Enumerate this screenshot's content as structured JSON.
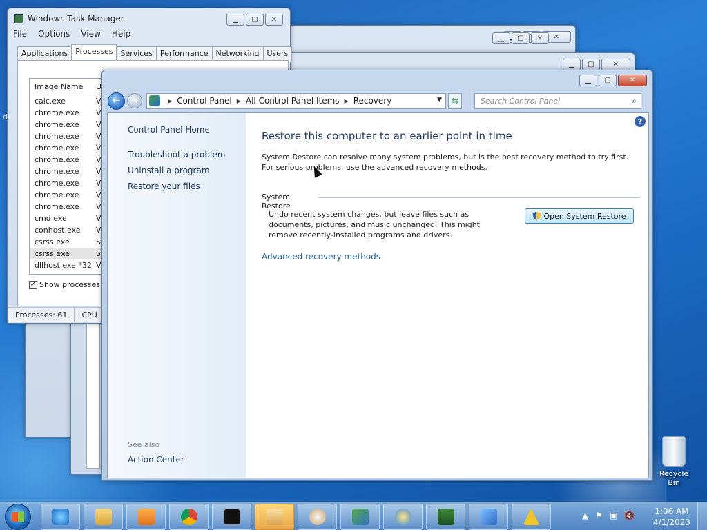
{
  "taskmgr": {
    "title": "Windows Task Manager",
    "menu": [
      "File",
      "Options",
      "View",
      "Help"
    ],
    "tabs": [
      "Applications",
      "Processes",
      "Services",
      "Performance",
      "Networking",
      "Users"
    ],
    "active_tab": "Processes",
    "column_image_name": "Image Name",
    "column_user_cut": "U",
    "processes": [
      {
        "name": "calc.exe",
        "user": "V"
      },
      {
        "name": "chrome.exe",
        "user": "V"
      },
      {
        "name": "chrome.exe",
        "user": "V"
      },
      {
        "name": "chrome.exe",
        "user": "V"
      },
      {
        "name": "chrome.exe",
        "user": "V"
      },
      {
        "name": "chrome.exe",
        "user": "V"
      },
      {
        "name": "chrome.exe",
        "user": "V"
      },
      {
        "name": "chrome.exe",
        "user": "V"
      },
      {
        "name": "chrome.exe",
        "user": "V"
      },
      {
        "name": "chrome.exe",
        "user": "V"
      },
      {
        "name": "cmd.exe",
        "user": "V"
      },
      {
        "name": "conhost.exe",
        "user": "V"
      },
      {
        "name": "csrss.exe",
        "user": "S"
      },
      {
        "name": "csrss.exe",
        "user": "S"
      },
      {
        "name": "dllhost.exe *32",
        "user": "V"
      }
    ],
    "show_processes_label": "Show processes fr",
    "status_processes": "Processes: 61",
    "status_cpu": "CPU"
  },
  "control_panel": {
    "breadcrumb": [
      "Control Panel",
      "All Control Panel Items",
      "Recovery"
    ],
    "search_placeholder": "Search Control Panel",
    "left_links": {
      "home": "Control Panel Home",
      "troubleshoot": "Troubleshoot a problem",
      "uninstall": "Uninstall a program",
      "restore_files": "Restore your files",
      "see_also": "See also",
      "action_center": "Action Center"
    },
    "heading": "Restore this computer to an earlier point in time",
    "intro": "System Restore can resolve many system problems, but is the best recovery method to try first. For serious problems, use the advanced recovery methods.",
    "section_title": "System Restore",
    "section_desc": "Undo recent system changes, but leave files such as documents, pictures, and music unchanged. This might remove recently-installed programs and drivers.",
    "open_system_restore": "Open System Restore",
    "advanced_link": "Advanced recovery methods"
  },
  "desktop": {
    "recycle_bin": "Recycle Bin",
    "left_letter": "d"
  },
  "taskbar": {
    "time": "1:06 AM",
    "date": "4/1/2023"
  }
}
